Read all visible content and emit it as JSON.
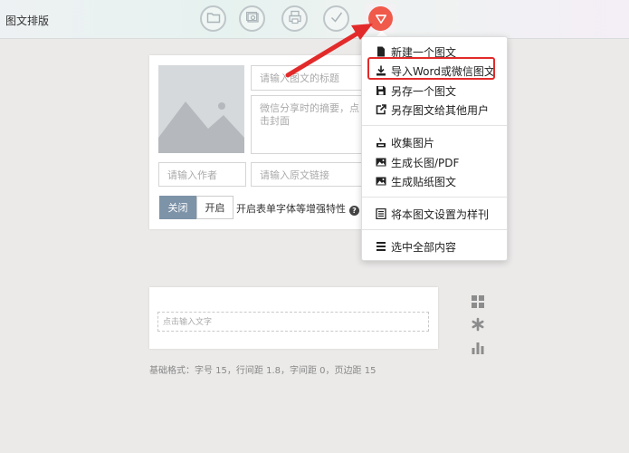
{
  "app": {
    "title": "图文排版"
  },
  "toolbar": {
    "buttons": [
      {
        "name": "folder",
        "icon": "folder-icon"
      },
      {
        "name": "images",
        "icon": "image-stack-icon"
      },
      {
        "name": "save",
        "icon": "printer-icon"
      },
      {
        "name": "check",
        "icon": "check-icon"
      },
      {
        "name": "menu",
        "icon": "triangle-down-icon",
        "color": "#f05a4a"
      }
    ]
  },
  "editor": {
    "title_placeholder": "请输入图文的标题",
    "summary_placeholder": "微信分享时的摘要，点击封面",
    "author_placeholder": "请输入作者",
    "link_placeholder": "请输入原文链接",
    "toggle_off": "关闭",
    "toggle_on": "开启",
    "feature_label": "开启表单字体等增强特性",
    "help_icon": "?"
  },
  "content": {
    "placeholder": "点击输入文字"
  },
  "base_format": "基础格式：字号 15，行间距 1.8，字间距 0，页边距 15",
  "menu": {
    "items": [
      {
        "label": "新建一个图文",
        "icon": "new-file-icon"
      },
      {
        "label": "导入Word或微信图文",
        "icon": "import-icon",
        "highlighted": true
      },
      {
        "label": "另存一个图文",
        "icon": "save-as-icon"
      },
      {
        "label": "另存图文给其他用户",
        "icon": "share-icon"
      },
      {
        "label": "收集图片",
        "icon": "collect-images-icon"
      },
      {
        "label": "生成长图/PDF",
        "icon": "picture-icon"
      },
      {
        "label": "生成贴纸图文",
        "icon": "sticker-icon"
      },
      {
        "label": "将本图文设置为样刊",
        "icon": "template-icon"
      },
      {
        "label": "选中全部内容",
        "icon": "select-all-icon"
      }
    ]
  },
  "colors": {
    "accent": "#f05a4a",
    "highlight": "#e32a2a",
    "toggle_active": "#7d93a8"
  }
}
